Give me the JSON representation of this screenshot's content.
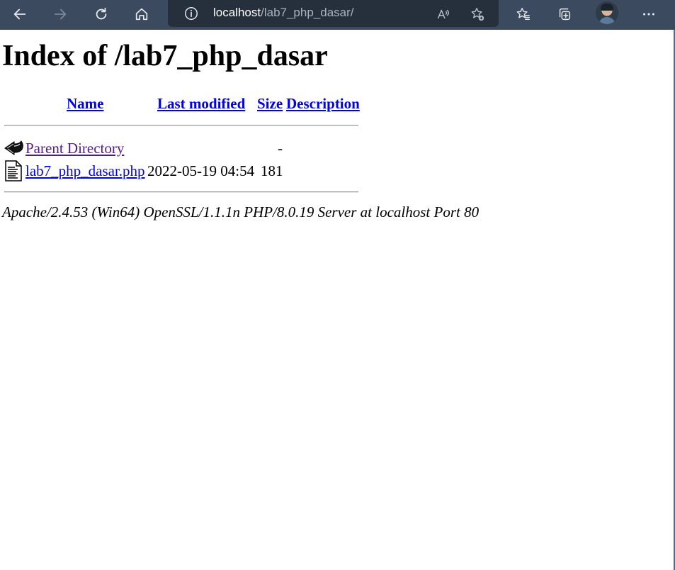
{
  "browser": {
    "address_host": "localhost",
    "address_path": "/lab7_php_dasar/",
    "icons": [
      "back-icon",
      "forward-icon",
      "refresh-icon",
      "home-icon",
      "site-info-icon",
      "read-aloud-icon",
      "add-favorite-icon",
      "favorites-icon",
      "collections-icon",
      "profile-avatar",
      "more-icon"
    ]
  },
  "page": {
    "title": "Index of /lab7_php_dasar",
    "columns": {
      "name": "Name",
      "last_modified": "Last modified",
      "size": "Size",
      "description": "Description"
    },
    "rows": [
      {
        "icon": "parent-directory-icon",
        "name": "Parent Directory",
        "modified": "",
        "size": "-",
        "description": ""
      },
      {
        "icon": "text-file-icon",
        "name": "lab7_php_dasar.php",
        "modified": "2022-05-19 04:54",
        "size": "181",
        "description": ""
      }
    ],
    "footer": "Apache/2.4.53 (Win64) OpenSSL/1.1.1n PHP/8.0.19 Server at localhost Port 80"
  },
  "colors": {
    "toolbar": "#3b4a5e",
    "address_bar": "#262f3c",
    "link": "#0000ee",
    "visited_link": "#551a8b"
  }
}
